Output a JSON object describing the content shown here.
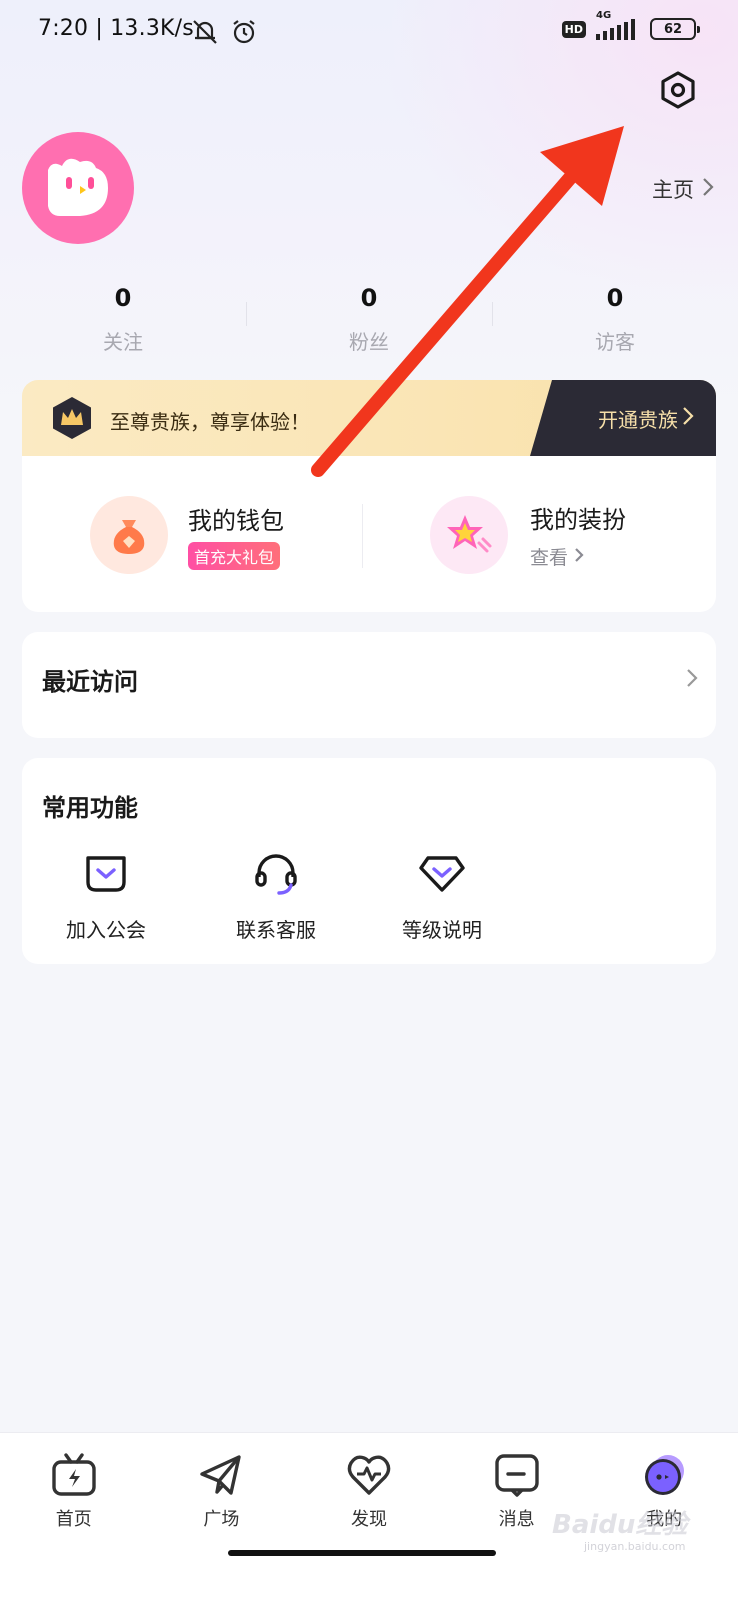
{
  "status_bar": {
    "time": "7:20",
    "speed": "| 13.3K/s",
    "network": "4G",
    "hd": "HD",
    "battery": "62"
  },
  "header": {
    "homepage_label": "主页"
  },
  "stats": [
    {
      "value": "0",
      "label": "关注"
    },
    {
      "value": "0",
      "label": "粉丝"
    },
    {
      "value": "0",
      "label": "访客"
    }
  ],
  "vip": {
    "text": "至尊贵族，尊享体验！",
    "button": "开通贵族"
  },
  "wallet": {
    "title": "我的钱包",
    "badge": "首充大礼包"
  },
  "dressup": {
    "title": "我的装扮",
    "link": "查看"
  },
  "recent": {
    "title": "最近访问"
  },
  "common": {
    "title": "常用功能",
    "items": [
      {
        "label": "加入公会",
        "icon": "guild-icon"
      },
      {
        "label": "联系客服",
        "icon": "headset-icon"
      },
      {
        "label": "等级说明",
        "icon": "level-icon"
      }
    ]
  },
  "nav": [
    {
      "label": "首页",
      "icon": "tv-icon"
    },
    {
      "label": "广场",
      "icon": "paper-plane-icon"
    },
    {
      "label": "发现",
      "icon": "heart-pulse-icon"
    },
    {
      "label": "消息",
      "icon": "message-icon"
    },
    {
      "label": "我的",
      "icon": "profile-avatar-icon"
    }
  ],
  "watermark": {
    "brand": "Baidu经验",
    "url": "jingyan.baidu.com"
  },
  "colors": {
    "accent_purple": "#7b61ff",
    "avatar_pink": "#ff6fb0",
    "arrow_red": "#f1361d",
    "vip_gold": "#f6dfa9"
  }
}
